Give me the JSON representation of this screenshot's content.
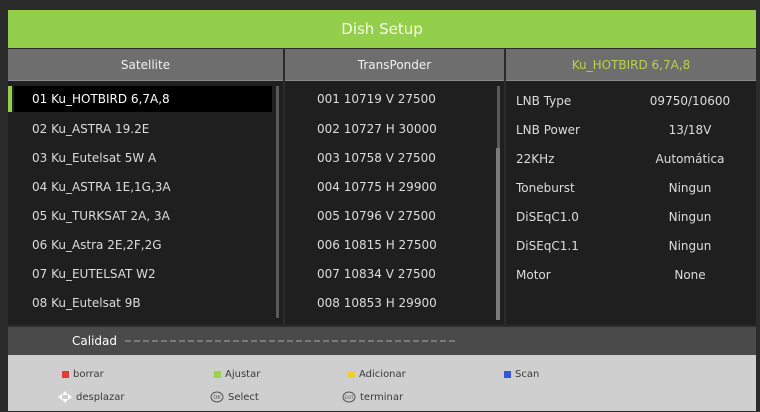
{
  "window": {
    "title": "Dish Setup"
  },
  "columns": {
    "satellite": "Satellite",
    "transponder": "TransPonder",
    "info_title": "Ku_HOTBIRD 6,7A,8"
  },
  "satellites": [
    "01 Ku_HOTBIRD 6,7A,8",
    "02 Ku_ASTRA 19.2E",
    "03 Ku_Eutelsat 5W A",
    "04 Ku_ASTRA 1E,1G,3A",
    "05 Ku_TURKSAT 2A, 3A",
    "06 Ku_Astra 2E,2F,2G",
    "07 Ku_EUTELSAT W2",
    "08 Ku_Eutelsat 9B"
  ],
  "selected_satellite_index": 0,
  "transponders": [
    "001 10719 V 27500",
    "002 10727 H 30000",
    "003 10758 V 27500",
    "004 10775 H 29900",
    "005 10796 V 27500",
    "006 10815 H 27500",
    "007 10834 V 27500",
    "008 10853 H 29900"
  ],
  "settings": [
    {
      "label": "LNB Type",
      "value": "09750/10600"
    },
    {
      "label": "LNB Power",
      "value": "13/18V"
    },
    {
      "label": "22KHz",
      "value": "Automática"
    },
    {
      "label": "Toneburst",
      "value": "Ningun"
    },
    {
      "label": "DiSEqC1.0",
      "value": "Ningun"
    },
    {
      "label": "DiSEqC1.1",
      "value": "Ningun"
    },
    {
      "label": "Motor",
      "value": "None"
    }
  ],
  "quality": {
    "label": "Calidad"
  },
  "legend": {
    "red": "borrar",
    "green": "Ajustar",
    "yellow": "Adicionar",
    "blue": "Scan",
    "move": "desplazar",
    "select": "Select",
    "exit": "terminar"
  },
  "colors": {
    "accent": "#93cf4a",
    "red_key": "#e33b3b",
    "green_key": "#9bd34a",
    "yellow_key": "#f2cf2a",
    "blue_key": "#2f58d8"
  }
}
